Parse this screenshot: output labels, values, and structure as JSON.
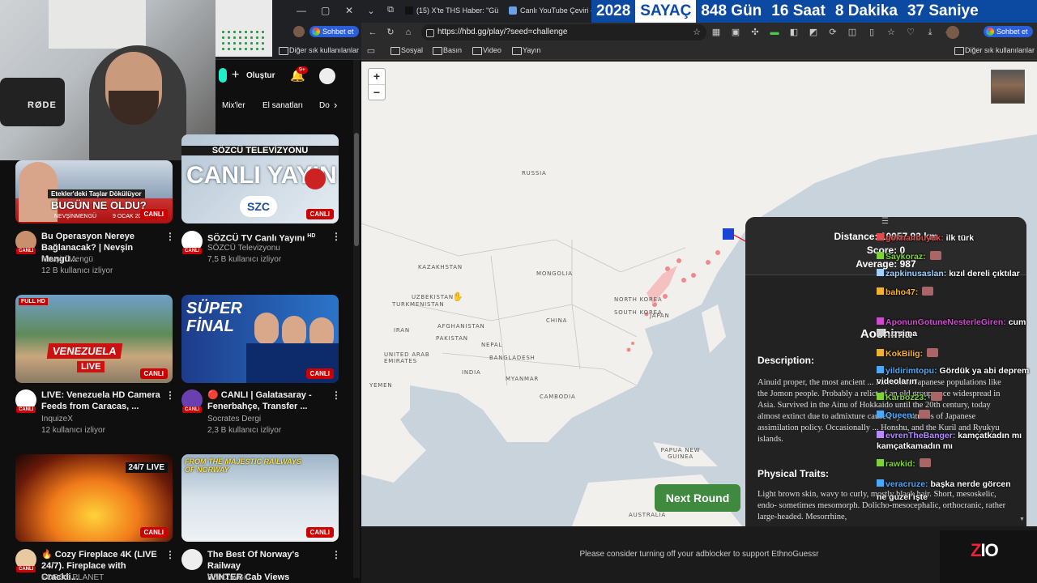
{
  "youtube": {
    "window_controls": [
      "—",
      "▢",
      "✕"
    ],
    "chat_chip": "Sohbet et",
    "bookmarks_other": "Diğer sık kullanılanlar",
    "create_label": "Oluştur",
    "notif_count": "9+",
    "categories": [
      "Mix'ler",
      "El sanatları",
      "Do"
    ],
    "webcam_brand": "RØDE",
    "live_badge": "CANLI",
    "videos": [
      {
        "thumb_text": "BUGÜN NE OLDU?",
        "thumb_sub": "Etekler'deki Taşlar Dökülüyor",
        "thumb_author": "NEVŞİNMENGÜ",
        "thumb_date": "9 OCAK 2025",
        "title1": "Bu Operasyon Nereye",
        "title2": "Bağlanacak? | Nevşin Mengü...",
        "channel": "Nevşin Mengü",
        "viewers": "12 B kullanıcı izliyor"
      },
      {
        "thumb_text": "CANLI YAYIN",
        "thumb_sub": "SÖZCÜ TELEVİZYONU",
        "thumb_logo": "SZC",
        "title1": "SÖZCÜ TV Canlı Yayını",
        "title_badge": "HD",
        "channel": "SÖZCÜ Televizyonu",
        "viewers": "7,5 B kullanıcı izliyor"
      },
      {
        "thumb_text": "VENEZUELA",
        "thumb_sub": "LIVE",
        "thumb_corner": "FULL HD",
        "title1": "LIVE: Venezuela HD Camera",
        "title2": "Feeds from Caracas, ...",
        "channel": "InquizeX",
        "viewers": "12 kullanıcı izliyor"
      },
      {
        "thumb_text": "SÜPER FİNAL",
        "title1": "🔴 CANLI | Galatasaray -",
        "title2": "Fenerbahçe, Transfer ...",
        "channel": "Socrates Dergi",
        "viewers": "2,3 B kullanıcı izliyor"
      },
      {
        "thumb_corner": "24/7 LIVE",
        "title1": "🔥 Cozy Fireplace 4K (LIVE",
        "title2": "24/7). Fireplace with Crackli...",
        "channel": "FOROS PLANET"
      },
      {
        "thumb_text": "FROM THE MAJESTIC RAILWAYS OF NORWAY",
        "title1": "The Best Of Norway's Railway",
        "title2": "WINTER Cab Views",
        "channel": "RailCowGirl"
      }
    ]
  },
  "browser": {
    "tabs": [
      {
        "label": "(15) X'te THS Haber: \"Gü",
        "icon_color": "#000000"
      },
      {
        "label": "Canlı YouTube Çeviri - A",
        "icon_color": "#6aa0e6"
      }
    ],
    "countdown": {
      "year": "2028",
      "label": "SAYAÇ",
      "days": "848 Gün",
      "hours": "16 Saat",
      "minutes": "8 Dakika",
      "seconds": "37 Saniye"
    },
    "url": "https://hbd.gg/play/?seed=challenge",
    "chat_chip": "Sohbet et",
    "bookmarks": [
      "Sosyal",
      "Basın",
      "Video",
      "Yayın"
    ],
    "bookmarks_other": "Diğer sık kullanılanlar"
  },
  "map": {
    "zoom_in": "+",
    "zoom_out": "−",
    "labels": [
      "RUSSIA",
      "KAZAKHSTAN",
      "MONGOLIA",
      "UZBEKISTAN",
      "TURKMENISTAN",
      "NORTH KOREA",
      "SOUTH KOREA",
      "JAPAN",
      "CHINA",
      "AFGHANISTAN",
      "IRAN",
      "PAKISTAN",
      "NEPAL",
      "UNITED ARAB EMIRATES",
      "BANGLADESH",
      "YEMEN",
      "INDIA",
      "MYANMAR",
      "CAMBODIA",
      "PAPUA NEW GUINEA",
      "AUSTRALIA"
    ],
    "next_round": "Next Round"
  },
  "panel": {
    "grip": "☰",
    "distance": "Distance: 10057.93 km",
    "score": "Score: 0",
    "average": "Average: 987",
    "name": "Aoshima",
    "description_h": "Description:",
    "description": "Ainuid proper, the most ancient ... Paleolithic Japanese populations like the Jomon people. Probably a relict of an old group once widespread in Asia. Survived in the Ainu of Hokkaido until the 20th century, today almost extinct due to admixture caused by centuries of Japanese assimilation policy. Occasionally ... Honshu, and the Kuril and Ryukyu islands.",
    "traits_h": "Physical Traits:",
    "traits": "Light brown skin, wavy to curly, mostly black hair. Short, mesoskelic, endo- sometimes mesomorph. Dolicho-mesocephalic, orthocranic, rather large-headed. Mesorrhine,"
  },
  "chat": [
    {
      "user": "gokhanbuyuk",
      "msg": "ilk türk",
      "color": "#e04a4a",
      "emote": false
    },
    {
      "user": "Saykoraz",
      "msg": "",
      "color": "#7fd13b",
      "emote": true
    },
    {
      "user": "zapkinusaslan",
      "msg": "kızıl dereli çıktılar",
      "color": "#9fd0ff",
      "emote": false
    },
    {
      "user": "baho47",
      "msg": "",
      "color": "#f0b232",
      "emote": true
    },
    {
      "user": "AponunGotuneNesterleGiren",
      "msg": "cum",
      "color": "#d04ad0",
      "emote": false
    },
    {
      "user": "...",
      "msg": "sima",
      "color": "#cccccc",
      "emote": false
    },
    {
      "user": "KokBilig",
      "msg": "",
      "color": "#f0b232",
      "emote": true
    },
    {
      "user": "yildirimtopu",
      "msg": "Gördük ya abi deprem videoların",
      "color": "#4aa8ff",
      "emote": false
    },
    {
      "user": "Karboz23",
      "msg": "",
      "color": "#7fd13b",
      "emote": true
    },
    {
      "user": "Queen",
      "msg": "",
      "color": "#4aa8ff",
      "emote": true
    },
    {
      "user": "evrenTheBanger",
      "msg": "kamçatkadın mı kamçatkamadın mı",
      "color": "#b58cff",
      "emote": false
    },
    {
      "user": "rawkid",
      "msg": "",
      "color": "#7fd13b",
      "emote": true
    },
    {
      "user": "veracruze",
      "msg": "başka nerde görcen",
      "color": "#4aa8ff",
      "emote": false
    },
    {
      "user": "",
      "msg": "ne guzel işte",
      "color": "#ffffff",
      "emote": false
    }
  ],
  "adbar": "Please consider turning off your adblocker to support EthnoGuessr",
  "logo": {
    "z": "Z",
    "rest": "IO"
  }
}
